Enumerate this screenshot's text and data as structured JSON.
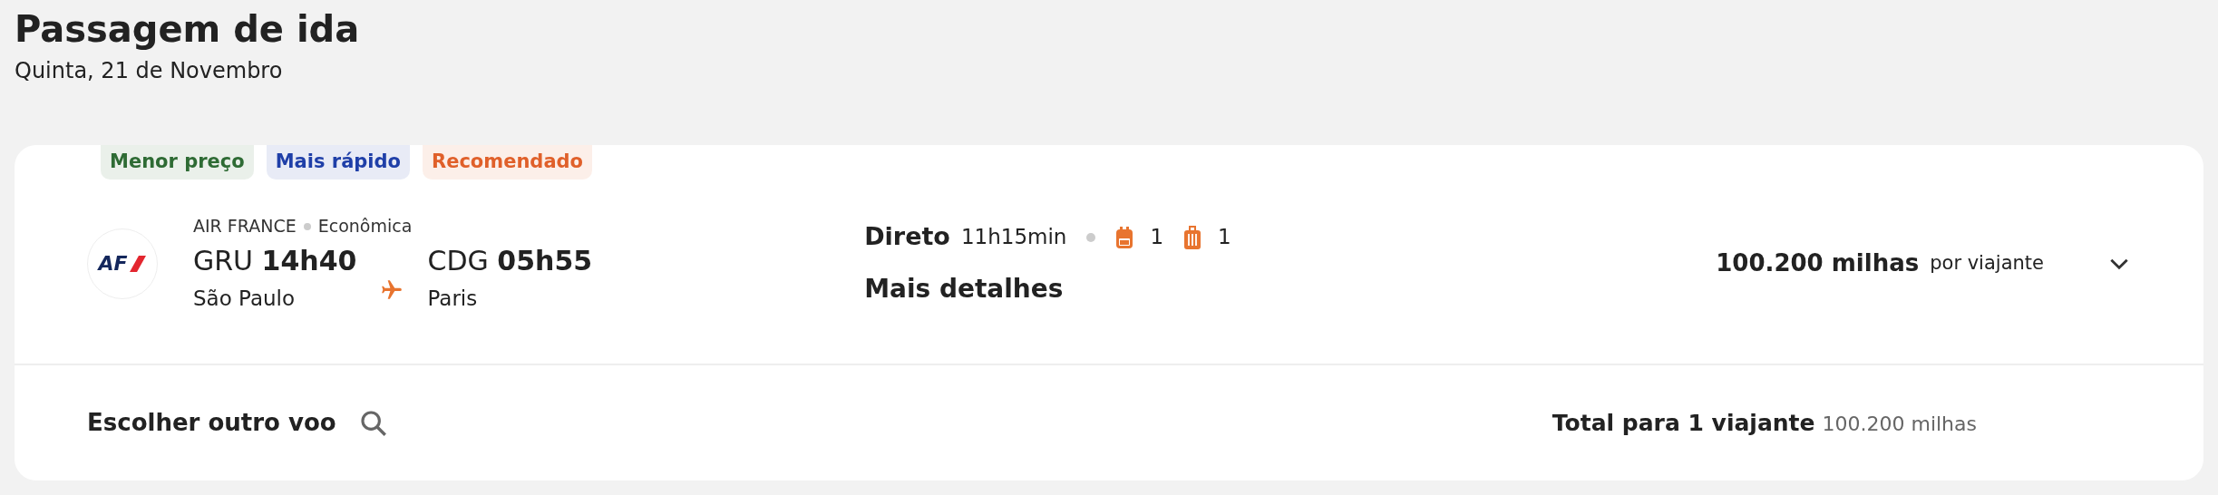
{
  "title": "Passagem de ida",
  "subtitle": "Quinta, 21 de Novembro",
  "tags": [
    {
      "label": "Menor preço",
      "color": "#2e6b34"
    },
    {
      "label": "Mais rápido",
      "color": "#1f3fa8"
    },
    {
      "label": "Recomendado",
      "color": "#e0602a"
    }
  ],
  "flight": {
    "airline": "AIR FRANCE",
    "cabin": "Econômica",
    "logo": "AF",
    "departure": {
      "code": "GRU",
      "time": "14h40",
      "city": "São Paulo"
    },
    "arrival": {
      "code": "CDG",
      "time": "05h55",
      "city": "Paris"
    },
    "stops": "Direto",
    "duration": "11h15min",
    "baggage": [
      {
        "kind": "backpack",
        "count": "1"
      },
      {
        "kind": "suitcase",
        "count": "1"
      }
    ],
    "details_link": "Mais detalhes"
  },
  "price": {
    "amount": "100.200 milhas",
    "note": "por viajante"
  },
  "footer": {
    "choose_other": "Escolher outro voo",
    "total_label": "Total para 1 viajante",
    "total_value": "100.200 milhas"
  }
}
